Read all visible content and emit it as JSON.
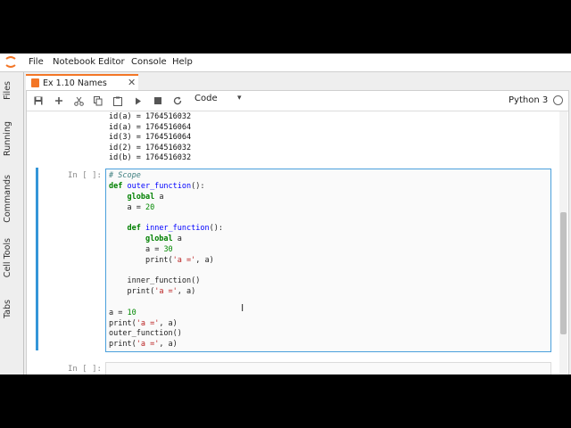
{
  "menubar": {
    "items": [
      "File",
      "Notebook",
      "Editor",
      "Console",
      "Help"
    ]
  },
  "sidebar": {
    "tabs": [
      "Files",
      "Running",
      "Commands",
      "Cell Tools",
      "Tabs"
    ]
  },
  "tab": {
    "title": "Ex 1.10 Names",
    "close": "✕"
  },
  "toolbar": {
    "cell_type": "Code",
    "kernel": "Python 3"
  },
  "output": {
    "lines": [
      "id(a) = 1764516032",
      "id(a) = 1764516064",
      "id(3) = 1764516064",
      "id(2) = 1764516032",
      "id(b) = 1764516032"
    ]
  },
  "cell": {
    "prompt": "In [ ]:",
    "next_prompt": "In [ ]:"
  },
  "code": {
    "comment": "# Scope",
    "def_outer_kw": "def",
    "def_outer_name": " outer_function",
    "def_outer_rest": "():",
    "global1_kw": "global",
    "global1_rest": " a",
    "assign20_pre": "a = ",
    "assign20_num": "20",
    "def_inner_kw": "def",
    "def_inner_name": " inner_function",
    "def_inner_rest": "():",
    "global2_kw": "global",
    "global2_rest": " a",
    "assign30_pre": "a = ",
    "assign30_num": "30",
    "print_inner_fn": "print",
    "print_inner_open": "(",
    "print_inner_str": "'a ='",
    "print_inner_close": ", a)",
    "call_inner": "inner_function()",
    "print_outer_fn": "print",
    "print_outer_open": "(",
    "print_outer_str": "'a ='",
    "print_outer_close": ", a)",
    "assign10_pre": "a = ",
    "assign10_num": "10",
    "print1_fn": "print",
    "print1_open": "(",
    "print1_str": "'a ='",
    "print1_close": ", a)",
    "call_outer": "outer_function()",
    "print2_fn": "print",
    "print2_open": "(",
    "print2_str": "'a ='",
    "print2_close": ", a)"
  },
  "colors": {
    "accent": "#f37626",
    "active_cell": "#3496d8"
  }
}
